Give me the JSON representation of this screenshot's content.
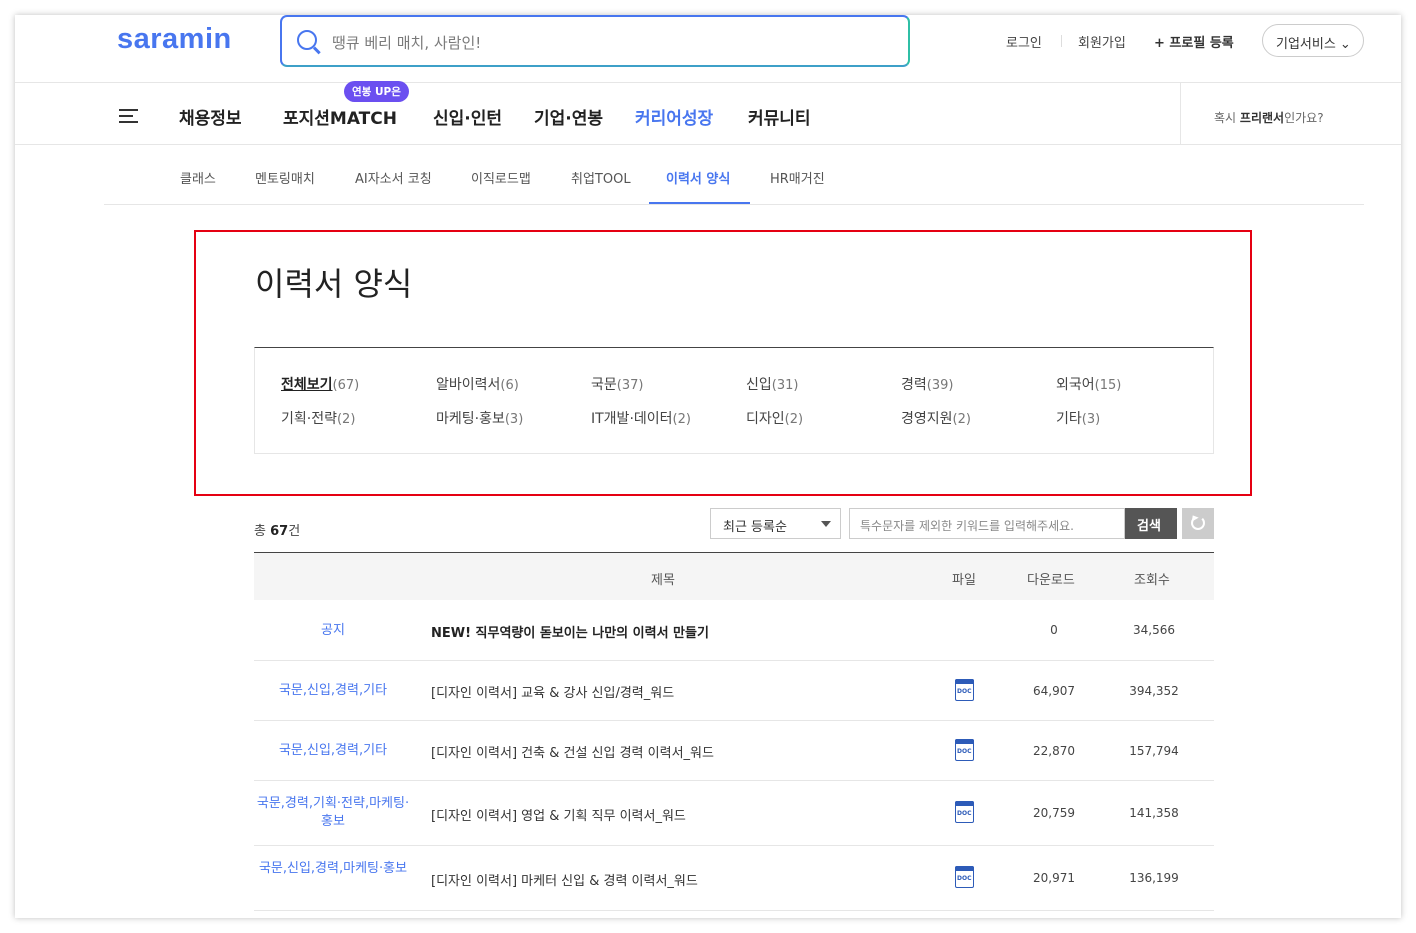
{
  "header": {
    "logo": "saramin",
    "search_placeholder": "땡큐 베리 매치, 사람인!",
    "login": "로그인",
    "signup": "회원가입",
    "profile_register": "+ 프로필 등록",
    "business_service": "기업서비스 ⌄"
  },
  "gnb": {
    "items": [
      "채용정보",
      "포지션MATCH",
      "신입·인턴",
      "기업·연봉",
      "커리어성장",
      "커뮤니티"
    ],
    "badge": "연봉 UP은",
    "freelancer_prefix": "혹시 ",
    "freelancer_bold": "프리랜서",
    "freelancer_suffix": "인가요?"
  },
  "subnav": {
    "items": [
      "클래스",
      "멘토링매치",
      "AI자소서 코칭",
      "이직로드맵",
      "취업TOOL",
      "이력서 양식",
      "HR매거진"
    ],
    "active": "이력서 양식"
  },
  "page_title": "이력서 양식",
  "categories": [
    {
      "label": "전체보기",
      "count": "(67)"
    },
    {
      "label": "알바이력서",
      "count": "(6)"
    },
    {
      "label": "국문",
      "count": "(37)"
    },
    {
      "label": "신입",
      "count": "(31)"
    },
    {
      "label": "경력",
      "count": "(39)"
    },
    {
      "label": "외국어",
      "count": "(15)"
    },
    {
      "label": "기획·전략",
      "count": "(2)"
    },
    {
      "label": "마케팅·홍보",
      "count": "(3)"
    },
    {
      "label": "IT개발·데이터",
      "count": "(2)"
    },
    {
      "label": "디자인",
      "count": "(2)"
    },
    {
      "label": "경영지원",
      "count": "(2)"
    },
    {
      "label": "기타",
      "count": "(3)"
    }
  ],
  "list": {
    "total_prefix": "총 ",
    "total_count": "67",
    "total_suffix": "건",
    "sort_selected": "최근 등록순",
    "keyword_placeholder": "특수문자를 제외한 키워드를 입력해주세요.",
    "search_button": "검색"
  },
  "table": {
    "headers": [
      "제목",
      "파일",
      "다운로드",
      "조회수"
    ],
    "rows": [
      {
        "category": "공지",
        "title": "NEW! 직무역량이 돋보이는 나만의 이력서 만들기",
        "file": "",
        "downloads": "0",
        "views": "34,566"
      },
      {
        "category": "국문,신입,경력,기타",
        "title": "[디자인 이력서] 교육 & 강사 신입/경력_워드",
        "file": "DOC",
        "downloads": "64,907",
        "views": "394,352"
      },
      {
        "category": "국문,신입,경력,기타",
        "title": "[디자인 이력서] 건축 & 건설 신입 경력 이력서_워드",
        "file": "DOC",
        "downloads": "22,870",
        "views": "157,794"
      },
      {
        "category": "국문,경력,기획·전략,마케팅·홍보",
        "title": "[디자인 이력서] 영업 & 기획 직무 이력서_워드",
        "file": "DOC",
        "downloads": "20,759",
        "views": "141,358"
      },
      {
        "category": "국문,신입,경력,마케팅·홍보",
        "title": "[디자인 이력서] 마케터 신입 & 경력 이력서_워드",
        "file": "DOC",
        "downloads": "20,971",
        "views": "136,199"
      }
    ]
  },
  "colors": {
    "brand": "#4876ef",
    "badge": "#6b4ff0",
    "highlight_border": "#e50012"
  }
}
